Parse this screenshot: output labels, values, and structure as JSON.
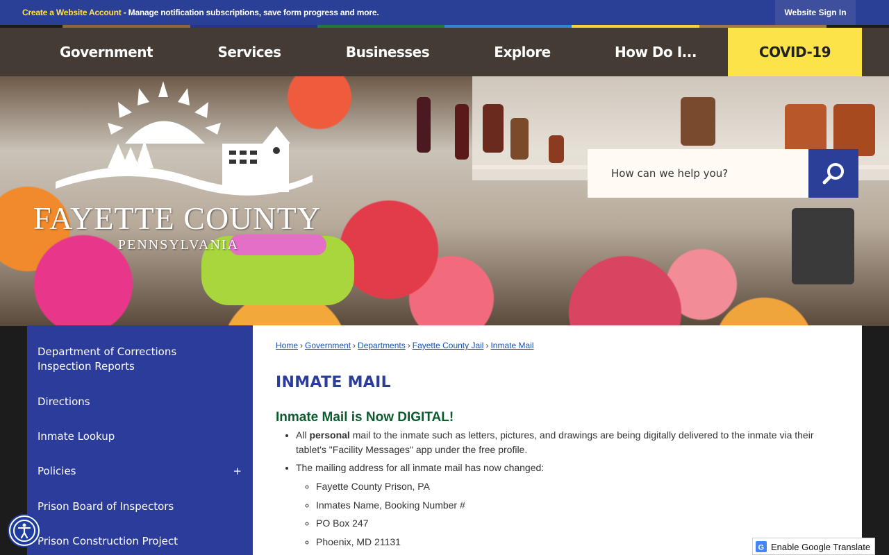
{
  "topbar": {
    "create_account": "Create a Website Account",
    "message": " - Manage notification subscriptions, save form progress and more.",
    "sign_in": "Website Sign In"
  },
  "nav": {
    "items": [
      "Government",
      "Services",
      "Businesses",
      "Explore",
      "How Do I...",
      "COVID-19"
    ]
  },
  "logo": {
    "title": "FAYETTE COUNTY",
    "subtitle": "PENNSYLVANIA"
  },
  "search": {
    "placeholder": "How can we help you?"
  },
  "sidebar": {
    "items": [
      {
        "label": "Department of Corrections Inspection Reports"
      },
      {
        "label": "Directions"
      },
      {
        "label": "Inmate Lookup"
      },
      {
        "label": "Policies",
        "expand": "+"
      },
      {
        "label": "Prison Board of Inspectors"
      },
      {
        "label": "Prison Construction Project"
      }
    ]
  },
  "breadcrumb": [
    "Home",
    "Government",
    "Departments",
    "Fayette County Jail",
    "Inmate Mail"
  ],
  "page": {
    "title": "INMATE MAIL",
    "subtitle": "Inmate Mail is Now DIGITAL!",
    "bullet1_pre": "All ",
    "bullet1_bold": "personal",
    "bullet1_post": " mail to the inmate such as letters, pictures, and drawings are being digitally delivered to the inmate via their tablet's \"Facility Messages\" app under the free profile.",
    "bullet2": "The mailing address for all inmate mail has now changed:",
    "address": [
      "Fayette County Prison, PA",
      "Inmates Name, Booking Number #",
      "PO Box 247",
      "Phoenix, MD 21131"
    ]
  },
  "translate": {
    "label": "Enable Google Translate"
  },
  "colors": {
    "brand_blue": "#2b3c9a",
    "covid_yellow": "#fce34a",
    "link": "#1a4fb0",
    "subtitle_green": "#0c5a2e"
  }
}
